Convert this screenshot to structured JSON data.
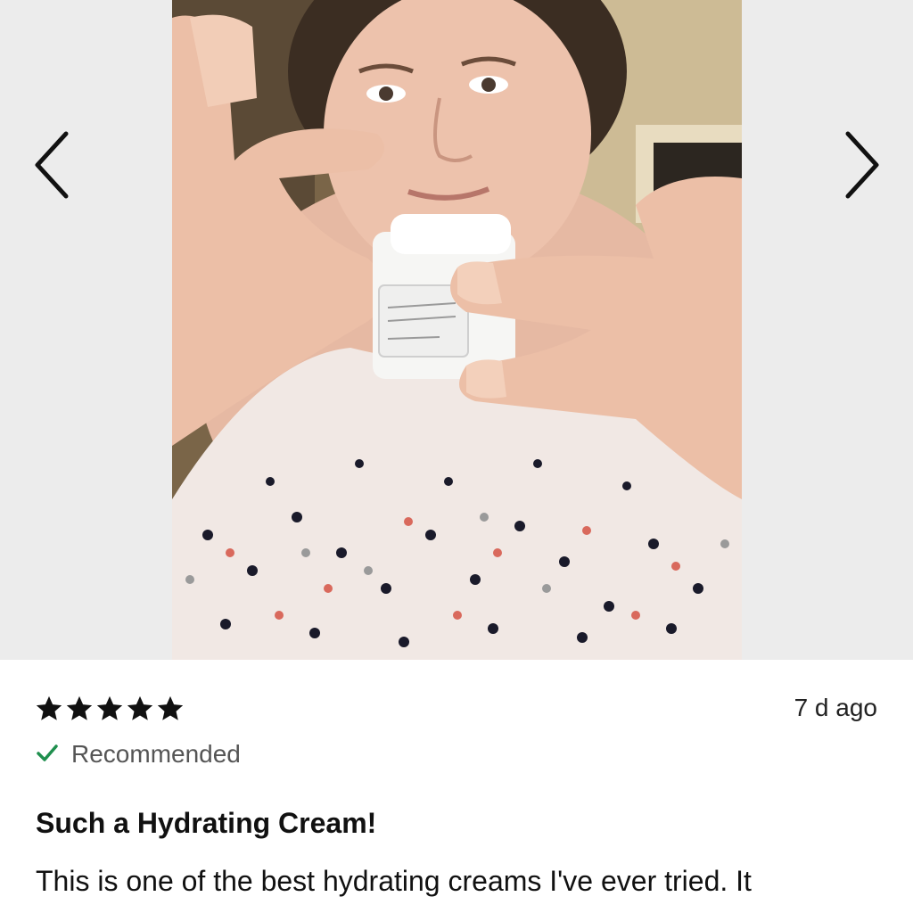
{
  "gallery": {
    "prev_icon": "chevron-left-icon",
    "next_icon": "chevron-right-icon",
    "photo_description_icon": "review-photo"
  },
  "review": {
    "rating": 5,
    "rating_max": 5,
    "star_icon": "star-filled-icon",
    "timestamp": "7 d ago",
    "recommended_icon": "checkmark-icon",
    "recommended_label": "Recommended",
    "title": "Such a Hydrating Cream!",
    "body": "This is one of the best hydrating creams I've ever tried. It"
  },
  "colors": {
    "background_gray": "#ececec",
    "check_green": "#1f8f4e",
    "text_dark": "#111111",
    "text_muted": "#555555"
  }
}
